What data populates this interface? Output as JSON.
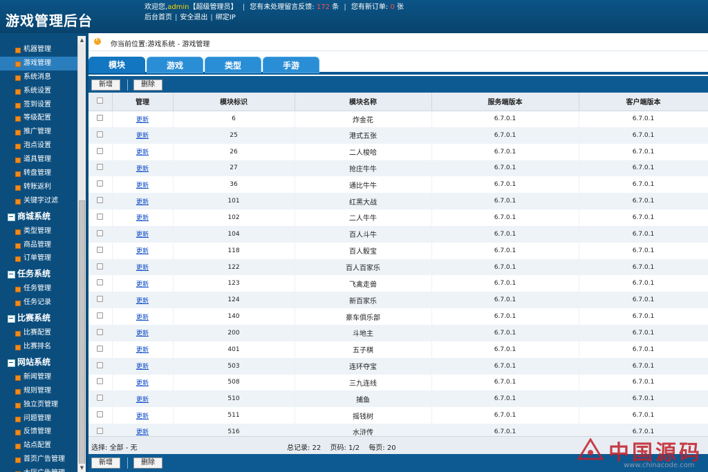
{
  "header": {
    "title": "游戏管理后台",
    "welcome_prefix": "欢迎您,",
    "username": "admin",
    "role": "【超级管理员】",
    "feedback_prefix": "您有未处理留言反馈:",
    "feedback_count": "172",
    "feedback_suffix": "条",
    "order_prefix": "您有新订单:",
    "order_count": "0",
    "order_suffix": "张",
    "links": [
      "后台首页",
      "安全退出",
      "绑定IP"
    ]
  },
  "sidebar": {
    "items": [
      {
        "label": "机器管理",
        "type": "sub"
      },
      {
        "label": "游戏管理",
        "type": "sub",
        "active": true
      },
      {
        "label": "系统消息",
        "type": "sub"
      },
      {
        "label": "系统设置",
        "type": "sub"
      },
      {
        "label": "签到设置",
        "type": "sub"
      },
      {
        "label": "等级配置",
        "type": "sub"
      },
      {
        "label": "推广管理",
        "type": "sub"
      },
      {
        "label": "泡点设置",
        "type": "sub"
      },
      {
        "label": "道具管理",
        "type": "sub"
      },
      {
        "label": "转盘管理",
        "type": "sub"
      },
      {
        "label": "转账返利",
        "type": "sub"
      },
      {
        "label": "关键字过滤",
        "type": "sub"
      },
      {
        "label": "商城系统",
        "type": "cat"
      },
      {
        "label": "类型管理",
        "type": "sub"
      },
      {
        "label": "商品管理",
        "type": "sub"
      },
      {
        "label": "订单管理",
        "type": "sub"
      },
      {
        "label": "任务系统",
        "type": "cat"
      },
      {
        "label": "任务管理",
        "type": "sub"
      },
      {
        "label": "任务记录",
        "type": "sub"
      },
      {
        "label": "比赛系统",
        "type": "cat"
      },
      {
        "label": "比赛配置",
        "type": "sub"
      },
      {
        "label": "比赛排名",
        "type": "sub"
      },
      {
        "label": "网站系统",
        "type": "cat"
      },
      {
        "label": "新闻管理",
        "type": "sub"
      },
      {
        "label": "规则管理",
        "type": "sub"
      },
      {
        "label": "独立页管理",
        "type": "sub"
      },
      {
        "label": "问题管理",
        "type": "sub"
      },
      {
        "label": "反馈管理",
        "type": "sub"
      },
      {
        "label": "站点配置",
        "type": "sub"
      },
      {
        "label": "首页广告管理",
        "type": "sub"
      },
      {
        "label": "大厅广告管理",
        "type": "sub"
      }
    ]
  },
  "breadcrumb": "你当前位置:游戏系统 - 游戏管理",
  "tabs": [
    {
      "label": "模块",
      "active": true
    },
    {
      "label": "游戏",
      "active": false
    },
    {
      "label": "类型",
      "active": false
    },
    {
      "label": "手游",
      "active": false
    }
  ],
  "toolbar": {
    "add_label": "新增",
    "delete_label": "删除"
  },
  "table": {
    "headers": [
      "管理",
      "模块标识",
      "模块名称",
      "服务端版本",
      "客户端版本"
    ],
    "update_link": "更新",
    "rows": [
      {
        "id": "6",
        "name": "炸金花",
        "server": "6.7.0.1",
        "client": "6.7.0.1"
      },
      {
        "id": "25",
        "name": "港式五张",
        "server": "6.7.0.1",
        "client": "6.7.0.1"
      },
      {
        "id": "26",
        "name": "二人梭哈",
        "server": "6.7.0.1",
        "client": "6.7.0.1"
      },
      {
        "id": "27",
        "name": "抢庄牛牛",
        "server": "6.7.0.1",
        "client": "6.7.0.1"
      },
      {
        "id": "36",
        "name": "通比牛牛",
        "server": "6.7.0.1",
        "client": "6.7.0.1"
      },
      {
        "id": "101",
        "name": "红黑大战",
        "server": "6.7.0.1",
        "client": "6.7.0.1"
      },
      {
        "id": "102",
        "name": "二人牛牛",
        "server": "6.7.0.1",
        "client": "6.7.0.1"
      },
      {
        "id": "104",
        "name": "百人斗牛",
        "server": "6.7.0.1",
        "client": "6.7.0.1"
      },
      {
        "id": "118",
        "name": "百人骰宝",
        "server": "6.7.0.1",
        "client": "6.7.0.1"
      },
      {
        "id": "122",
        "name": "百人百家乐",
        "server": "6.7.0.1",
        "client": "6.7.0.1"
      },
      {
        "id": "123",
        "name": "飞禽走兽",
        "server": "6.7.0.1",
        "client": "6.7.0.1"
      },
      {
        "id": "124",
        "name": "新百家乐",
        "server": "6.7.0.1",
        "client": "6.7.0.1"
      },
      {
        "id": "140",
        "name": "豪车俱乐部",
        "server": "6.7.0.1",
        "client": "6.7.0.1"
      },
      {
        "id": "200",
        "name": "斗地主",
        "server": "6.7.0.1",
        "client": "6.7.0.1"
      },
      {
        "id": "401",
        "name": "五子棋",
        "server": "6.7.0.1",
        "client": "6.7.0.1"
      },
      {
        "id": "503",
        "name": "连环夺宝",
        "server": "6.7.0.1",
        "client": "6.7.0.1"
      },
      {
        "id": "508",
        "name": "三九连线",
        "server": "6.7.0.1",
        "client": "6.7.0.1"
      },
      {
        "id": "510",
        "name": "捕鱼",
        "server": "6.7.0.1",
        "client": "6.7.0.1"
      },
      {
        "id": "511",
        "name": "摇钱树",
        "server": "6.7.0.1",
        "client": "6.7.0.1"
      },
      {
        "id": "516",
        "name": "水浒传",
        "server": "6.7.0.1",
        "client": "6.7.0.1"
      }
    ]
  },
  "footer": {
    "select_label": "选择:",
    "select_all": "全部",
    "select_dash": "-",
    "select_none": "无",
    "total": "总记录: 22",
    "page": "页码: 1/2",
    "per_page": "每页: 20"
  },
  "watermark": {
    "text": "中国源码",
    "url": "www.chinacode.com"
  }
}
